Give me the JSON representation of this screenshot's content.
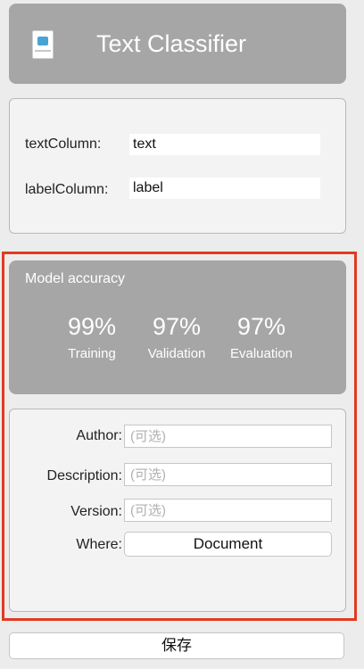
{
  "header": {
    "title": "Text Classifier",
    "icon": "text-classifier-file-icon"
  },
  "columns": {
    "text_column_label": "textColumn:",
    "text_column_value": "text",
    "label_column_label": "labelColumn:",
    "label_column_value": "label"
  },
  "accuracy": {
    "title": "Model accuracy",
    "metrics": [
      {
        "value": "99%",
        "label": "Training"
      },
      {
        "value": "97%",
        "label": "Validation"
      },
      {
        "value": "97%",
        "label": "Evaluation"
      }
    ]
  },
  "metadata": {
    "author_label": "Author:",
    "author_placeholder": "(可选)",
    "description_label": "Description:",
    "description_placeholder": "(可选)",
    "version_label": "Version:",
    "version_placeholder": "(可选)",
    "where_label": "Where:",
    "where_value": "Document"
  },
  "save_label": "保存",
  "colors": {
    "highlight": "#e03b22",
    "card": "#a6a6a6"
  }
}
